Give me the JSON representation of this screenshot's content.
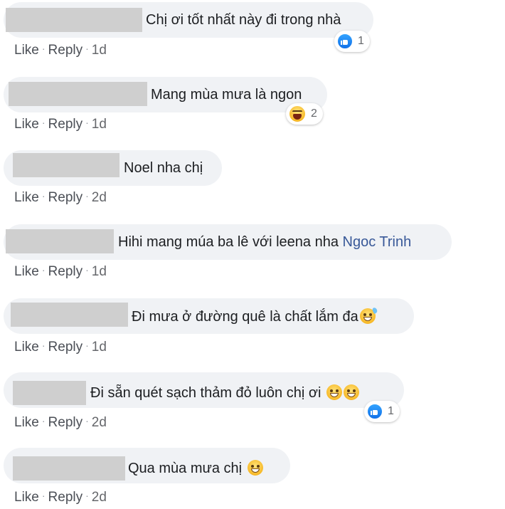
{
  "colors": {
    "bubble": "#f0f2f5",
    "text": "#1c1e21",
    "meta": "#65676b",
    "mention": "#385898",
    "like_blue": "#1877f2",
    "redaction": "#cfcfcf"
  },
  "actions": {
    "like": "Like",
    "reply": "Reply",
    "separator": "·"
  },
  "comments": [
    {
      "text": "Chị ơi tốt nhất này đi trong nhà",
      "age": "1d",
      "reaction": {
        "icon": "like-icon",
        "count": "1"
      }
    },
    {
      "text": "Mang mùa mưa là ngon",
      "age": "1d",
      "reaction": {
        "icon": "haha-icon",
        "count": "2"
      }
    },
    {
      "text": "Noel nha chị",
      "age": "2d"
    },
    {
      "text": "Hihi mang múa ba lê với leena nha",
      "mention": "Ngoc Trinh",
      "age": "1d"
    },
    {
      "text": "Đi mưa ở đường quê là chất lắm đa",
      "emoji": "grinning-sweat-emoji",
      "age": "1d"
    },
    {
      "text": "Đi sẵn quét sạch thảm đỏ luôn chị ơi",
      "emoji": "beaming-grin-emoji-x2",
      "age": "2d",
      "reaction": {
        "icon": "like-icon",
        "count": "1"
      }
    },
    {
      "text": "Qua mùa mưa chị",
      "emoji": "beaming-grin-emoji",
      "age": "2d"
    }
  ]
}
